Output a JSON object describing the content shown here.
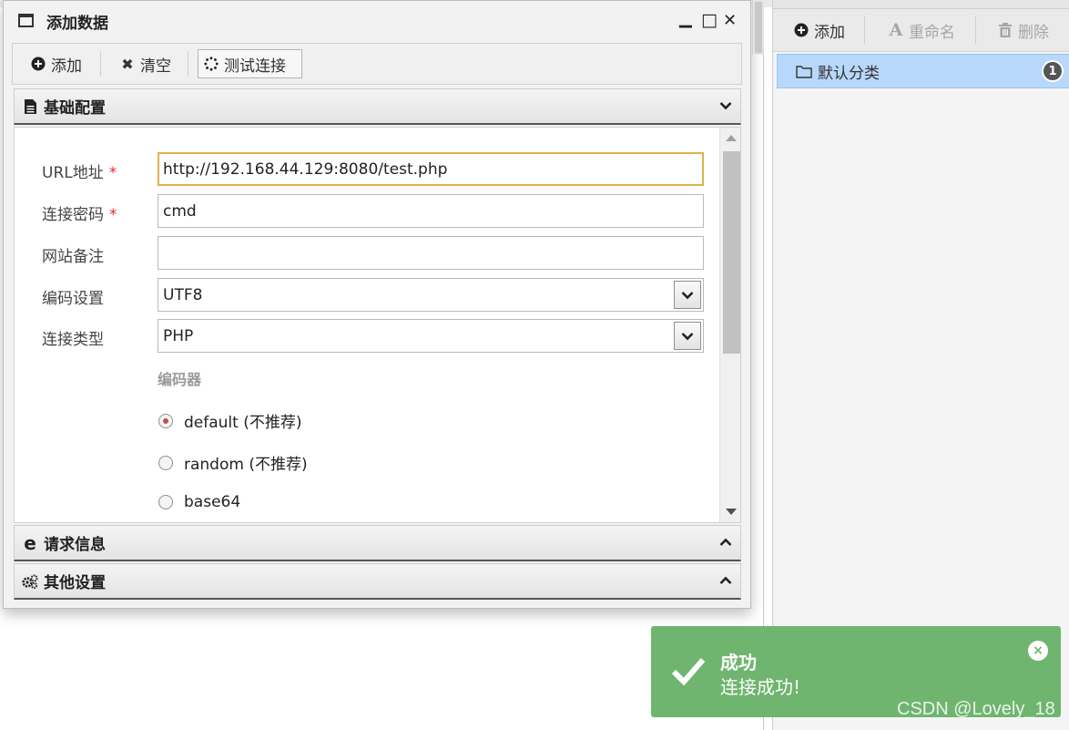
{
  "dialog": {
    "title": "添加数据",
    "minimize_glyph": "▁",
    "maximize_glyph": "□",
    "close_glyph": "✕",
    "toolbar": {
      "add_label": "添加",
      "clear_label": "清空",
      "test_label": "测试连接"
    },
    "sections": {
      "basic": "基础配置",
      "request": "请求信息",
      "other": "其他设置"
    },
    "form": {
      "url_label": "URL地址",
      "url_value": "http://192.168.44.129:8080/test.php",
      "password_label": "连接密码",
      "password_value": "cmd",
      "note_label": "网站备注",
      "note_value": "",
      "encoding_label": "编码设置",
      "encoding_value": "UTF8",
      "type_label": "连接类型",
      "type_value": "PHP",
      "required_mark": "*",
      "encoder_title": "编码器",
      "encoders": [
        {
          "label": "default (不推荐)",
          "checked": true
        },
        {
          "label": "random (不推荐)",
          "checked": false
        },
        {
          "label": "base64",
          "checked": false
        }
      ]
    }
  },
  "right_panel": {
    "toolbar": {
      "add_label": "添加",
      "rename_label": "重命名",
      "delete_label": "删除"
    },
    "category": {
      "label": "默认分类",
      "count": "1"
    }
  },
  "toast": {
    "title": "成功",
    "message": "连接成功!",
    "close_glyph": "×",
    "color": "#6fb56f"
  },
  "watermark": "CSDN @Lovely_18",
  "colors": {
    "selection": "#b7d8fb",
    "focus_border": "#e0b050",
    "required": "#e03030"
  }
}
